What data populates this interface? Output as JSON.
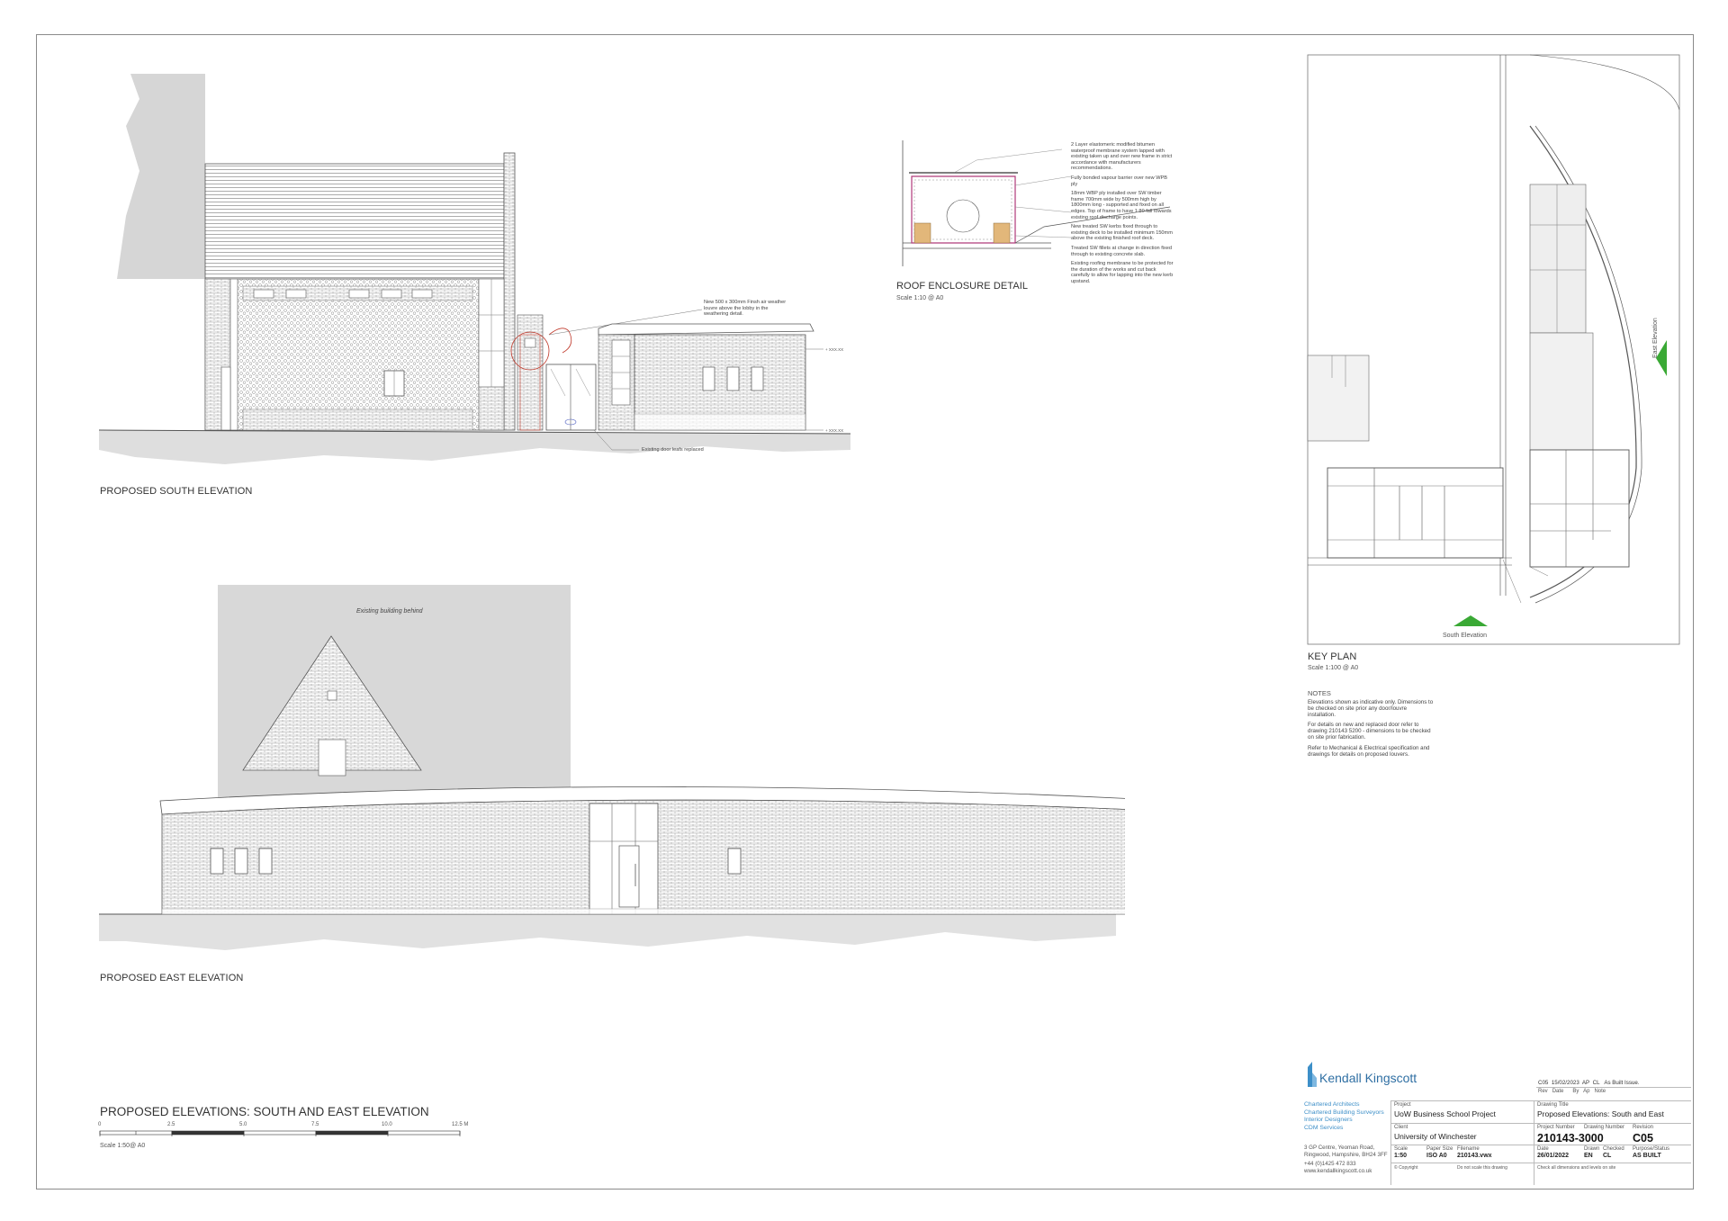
{
  "south_elevation": {
    "title": "PROPOSED SOUTH ELEVATION",
    "annotations": {
      "louvres": "New 500 x 300mm Finsh air weather louvre above the lobby in the weathering detail.",
      "door": "Existing door leafs replaced",
      "level_upper": "+ XXX.XX",
      "level_lower": "+ XXX.XX"
    }
  },
  "east_elevation": {
    "title": "PROPOSED EAST ELEVATION",
    "annotation": "Existing building behind"
  },
  "roof_detail": {
    "title": "ROOF ENCLOSURE DETAIL",
    "scale": "Scale 1:10 @ A0",
    "notes": [
      "2 Layer elastomeric modified bitumen waterproof membrane system lapped with existing taken up and over new frame in strict accordance with manufacturers recommendations.",
      "Fully bonded vapour barrier over new WPB ply",
      "18mm WBP ply installed over SW timber frame 700mm wide by 500mm high by 1800mm long - supported and fixed on all edges. Top of frame to have 1:80 fall towards existing roof discharge points.",
      "New treated SW kerbs fixed through to existing deck to be installed minimum 150mm above the existing finished roof deck.",
      "Treated SW fillets at change in direction fixed through to existing concrete slab.",
      "Existing roofing membrane to be protected for the duration of the works and cut back carefully to allow for lapping into the new kerb upstand."
    ]
  },
  "key_plan": {
    "title": "KEY PLAN",
    "scale": "Scale 1:100 @ A0",
    "south_label": "South Elevation",
    "east_label": "East Elevation",
    "accent": "#3aa935"
  },
  "notes": {
    "heading": "NOTES",
    "items": [
      "Elevations shown as indicative only. Dimensions to be checked on site prior any door/louvre installation.",
      "For details on new and replaced door refer to drawing 210143 5200 - dimensions to be checked on site prior fabrication.",
      "Refer to Mechanical & Electrical specification and drawings for details on proposed louvers."
    ]
  },
  "sheet_title": {
    "title": "PROPOSED ELEVATIONS: SOUTH AND EAST ELEVATION",
    "scale_ticks": [
      "0",
      "2.5",
      "5.0",
      "7.5",
      "10.0",
      "12.5 M"
    ],
    "scale": "Scale 1:50@ A0"
  },
  "title_block": {
    "company": "Kendall Kingscott",
    "services": [
      "Chartered Architects",
      "Chartered Building Surveyors",
      "Interior Designers",
      "CDM Services"
    ],
    "address": [
      "3 GP Centre, Yeoman Road,",
      "Ringwood, Hampshire, BH24 3FF"
    ],
    "phone": "+44 (0)1425 472 833",
    "website": "www.kendallkingscott.co.uk",
    "revision_row": [
      "C05",
      "15/02/2023",
      "AP",
      "CL",
      "As Built Issue."
    ],
    "revision_heads": [
      "Rev",
      "Date",
      "By",
      "Ap",
      "Note"
    ],
    "project_label": "Project",
    "project": "UoW Business School Project",
    "client_label": "Client",
    "client": "University of Winchester",
    "drawing_title_label": "Drawing Title",
    "drawing_title": "Proposed Elevations: South and East",
    "project_number_label": "Project Number",
    "drawing_number_label": "Drawing Number",
    "drawing_number": "210143-3000",
    "revision_label": "Revision",
    "revision": "C05",
    "scale_label": "Scale",
    "scale": "1:50",
    "paper_label": "Paper Size",
    "paper": "ISO A0",
    "filename_label": "Filename",
    "filename": "210143.vwx",
    "date_label": "Date",
    "date": "26/01/2022",
    "drawn_label": "Drawn",
    "drawn": "EN",
    "checked_label": "Checked",
    "checked": "CL",
    "purpose_label": "Purpose/Status",
    "purpose": "AS BUILT",
    "copyright": "© Copyright",
    "do_not_scale": "Do not scale this drawing",
    "check_dims": "Check all dimensions and levels on site",
    "brand_color": "#3d8fc8"
  }
}
